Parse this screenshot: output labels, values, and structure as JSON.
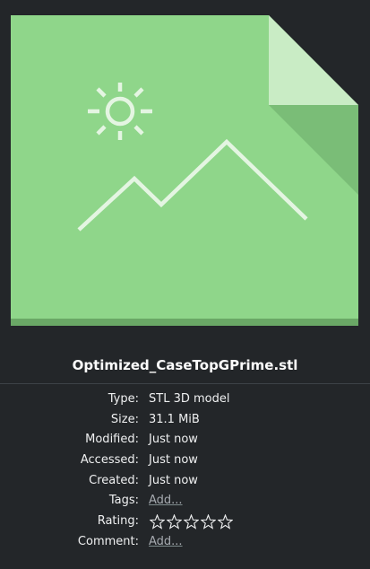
{
  "preview": {
    "icon": "image-file-icon",
    "colors": {
      "base": "#8fd68a",
      "fold": "#c9ecc5",
      "shadow": "#77b873",
      "bottom_edge": "#6aa866",
      "lines": "#e4f5e2"
    }
  },
  "file": {
    "name": "Optimized_CaseTopGPrime.stl"
  },
  "properties": [
    {
      "key": "type",
      "label": "Type:",
      "value": "STL 3D model"
    },
    {
      "key": "size",
      "label": "Size:",
      "value": "31.1 MiB"
    },
    {
      "key": "modified",
      "label": "Modified:",
      "value": "Just now"
    },
    {
      "key": "accessed",
      "label": "Accessed:",
      "value": "Just now"
    },
    {
      "key": "created",
      "label": "Created:",
      "value": "Just now"
    },
    {
      "key": "tags",
      "label": "Tags:",
      "value": "Add..."
    },
    {
      "key": "rating",
      "label": "Rating:",
      "stars_filled": 0,
      "stars_total": 5,
      "star_icon": "star-outline-icon"
    },
    {
      "key": "comment",
      "label": "Comment:",
      "value": "Add..."
    }
  ]
}
